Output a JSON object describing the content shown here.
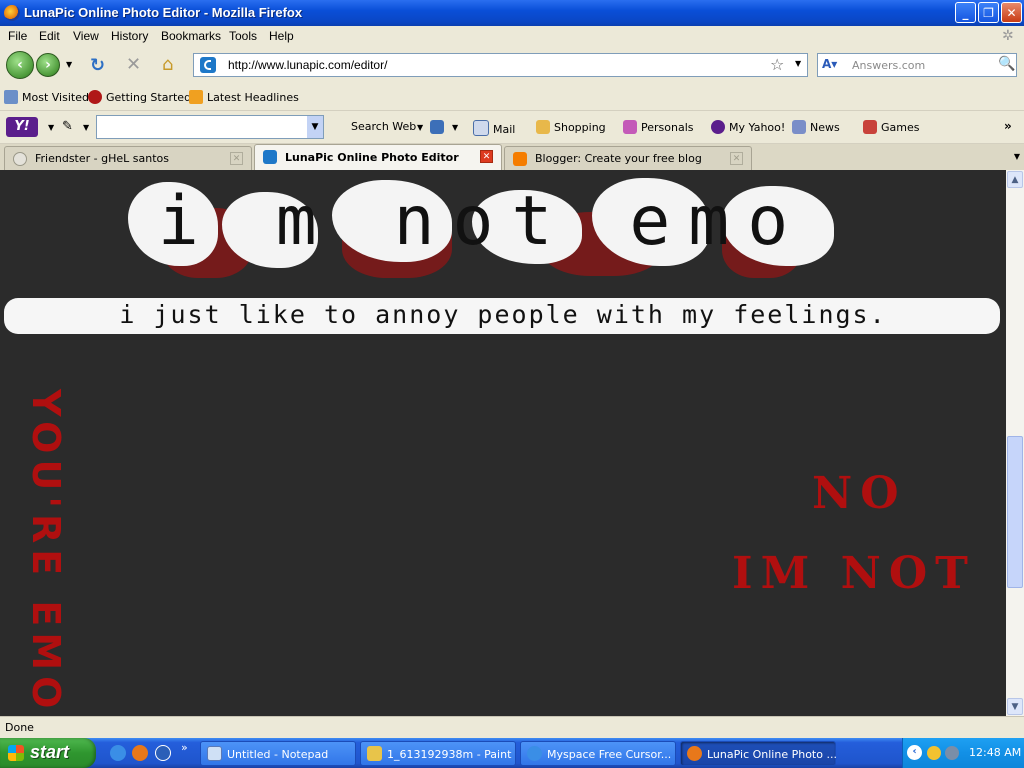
{
  "window": {
    "title": "LunaPic Online Photo Editor - Mozilla Firefox"
  },
  "menu": [
    "File",
    "Edit",
    "View",
    "History",
    "Bookmarks",
    "Tools",
    "Help"
  ],
  "nav": {
    "url": "http://www.lunapic.com/editor/",
    "search_placeholder": "Answers.com"
  },
  "bookmarks": [
    "Most Visited",
    "Getting Started",
    "Latest Headlines"
  ],
  "yahoo_toolbar": {
    "search_web": "Search Web",
    "items": [
      "Mail",
      "Shopping",
      "Personals",
      "My Yahoo!",
      "News",
      "Games"
    ]
  },
  "tabs": [
    {
      "label": "Friendster - gHeL santos",
      "active": false
    },
    {
      "label": "LunaPic Online Photo Editor",
      "active": true
    },
    {
      "label": "Blogger: Create your free blog",
      "active": false
    }
  ],
  "content": {
    "banner_title": "i m not emo",
    "banner_subtitle": "i just like to annoy people with my feelings.",
    "vertical_text": "YOU'RE EMO",
    "red_no": "NO",
    "red_imnot": "IM NOT"
  },
  "status": "Done",
  "taskbar": {
    "start": "start",
    "tasks": [
      "Untitled - Notepad",
      "1_613192938m - Paint",
      "Myspace Free Cursor...",
      "LunaPic Online Photo ..."
    ],
    "clock": "12:48 AM"
  },
  "colors": {
    "accent_red": "#b00f0f",
    "content_bg": "#2b2b2b"
  }
}
